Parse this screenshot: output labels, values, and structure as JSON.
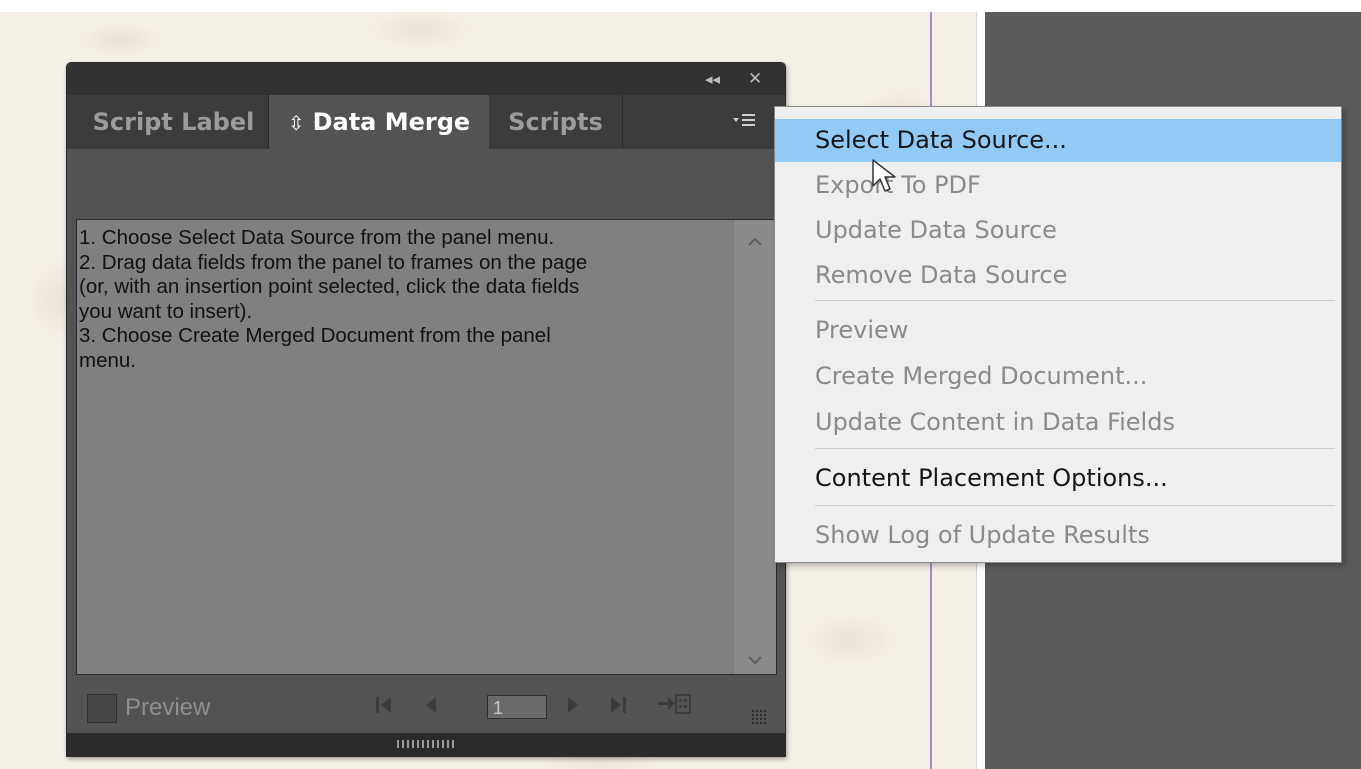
{
  "panel": {
    "title_buttons": {
      "collapse": "◂◂",
      "close": "✕"
    },
    "tabs": [
      {
        "label": "Script Label",
        "active": false
      },
      {
        "label": "Data Merge",
        "active": true
      },
      {
        "label": "Scripts",
        "active": false
      }
    ],
    "active_tab_glyph": "⇳",
    "menu_icon": "panel-menu-icon",
    "instructions": "1. Choose Select Data Source from the panel menu.\n2. Drag data fields from the panel to frames on the page\n(or, with an insertion point selected, click the data fields\nyou want to insert).\n3. Choose Create Merged Document from the panel\nmenu.",
    "footer": {
      "preview_label": "Preview",
      "preview_checked": false,
      "record_number": "1"
    }
  },
  "menu": {
    "items": [
      {
        "label": "Select Data Source...",
        "enabled": true,
        "highlighted": true
      },
      {
        "label": "Export To PDF",
        "enabled": false
      },
      {
        "label": "Update Data Source",
        "enabled": false
      },
      {
        "label": "Remove Data Source",
        "enabled": false
      },
      {
        "label": "Preview",
        "enabled": false
      },
      {
        "label": "Create Merged Document...",
        "enabled": false
      },
      {
        "label": "Update Content in Data Fields",
        "enabled": false
      },
      {
        "label": "Content Placement Options...",
        "enabled": true
      },
      {
        "label": "Show Log of Update Results",
        "enabled": false
      }
    ],
    "highlight_color": "#91c9f7"
  },
  "colors": {
    "panel_bg": "#535353",
    "tab_bar_bg": "#3c3c3c",
    "pasteboard": "#5b5b5b",
    "guide_line": "#a98ad0"
  }
}
